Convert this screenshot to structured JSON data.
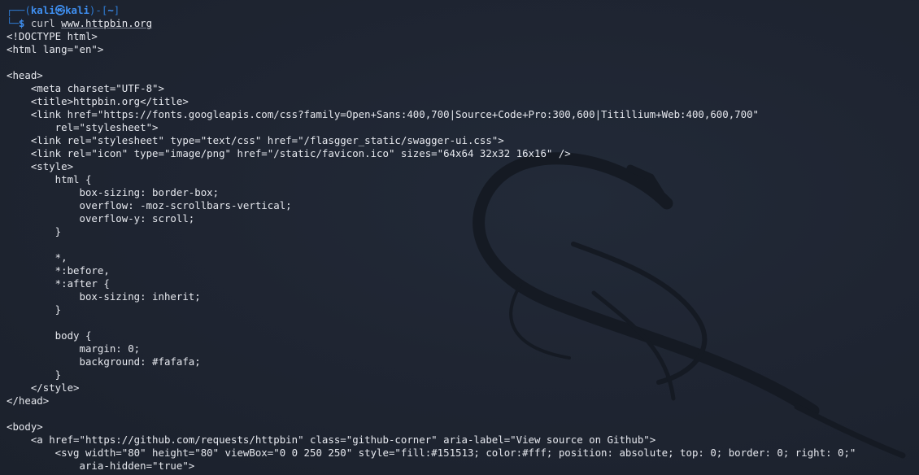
{
  "terminal": {
    "prompt": {
      "open": "┌──(",
      "user": "kali",
      "at": "㉿",
      "host": "kali",
      "mid": ")-[",
      "dir": "~",
      "close": "]",
      "corner": "└─",
      "dollar": "$",
      "command": "curl",
      "command_arg": "www.httpbin.org"
    },
    "output": [
      "<!DOCTYPE html>",
      "<html lang=\"en\">",
      "",
      "<head>",
      "    <meta charset=\"UTF-8\">",
      "    <title>httpbin.org</title>",
      "    <link href=\"https://fonts.googleapis.com/css?family=Open+Sans:400,700|Source+Code+Pro:300,600|Titillium+Web:400,600,700\"",
      "        rel=\"stylesheet\">",
      "    <link rel=\"stylesheet\" type=\"text/css\" href=\"/flasgger_static/swagger-ui.css\">",
      "    <link rel=\"icon\" type=\"image/png\" href=\"/static/favicon.ico\" sizes=\"64x64 32x32 16x16\" />",
      "    <style>",
      "        html {",
      "            box-sizing: border-box;",
      "            overflow: -moz-scrollbars-vertical;",
      "            overflow-y: scroll;",
      "        }",
      "",
      "        *,",
      "        *:before,",
      "        *:after {",
      "            box-sizing: inherit;",
      "        }",
      "",
      "        body {",
      "            margin: 0;",
      "            background: #fafafa;",
      "        }",
      "    </style>",
      "</head>",
      "",
      "<body>",
      "    <a href=\"https://github.com/requests/httpbin\" class=\"github-corner\" aria-label=\"View source on Github\">",
      "        <svg width=\"80\" height=\"80\" viewBox=\"0 0 250 250\" style=\"fill:#151513; color:#fff; position: absolute; top: 0; border: 0; right: 0;\"",
      "            aria-hidden=\"true\">"
    ]
  },
  "colors": {
    "background": "#1d232f",
    "prompt_frame": "#2e7ad1",
    "prompt_user": "#3f8ff0",
    "text": "#e6e8ee",
    "wallpaper_dragon": "#151a23"
  }
}
